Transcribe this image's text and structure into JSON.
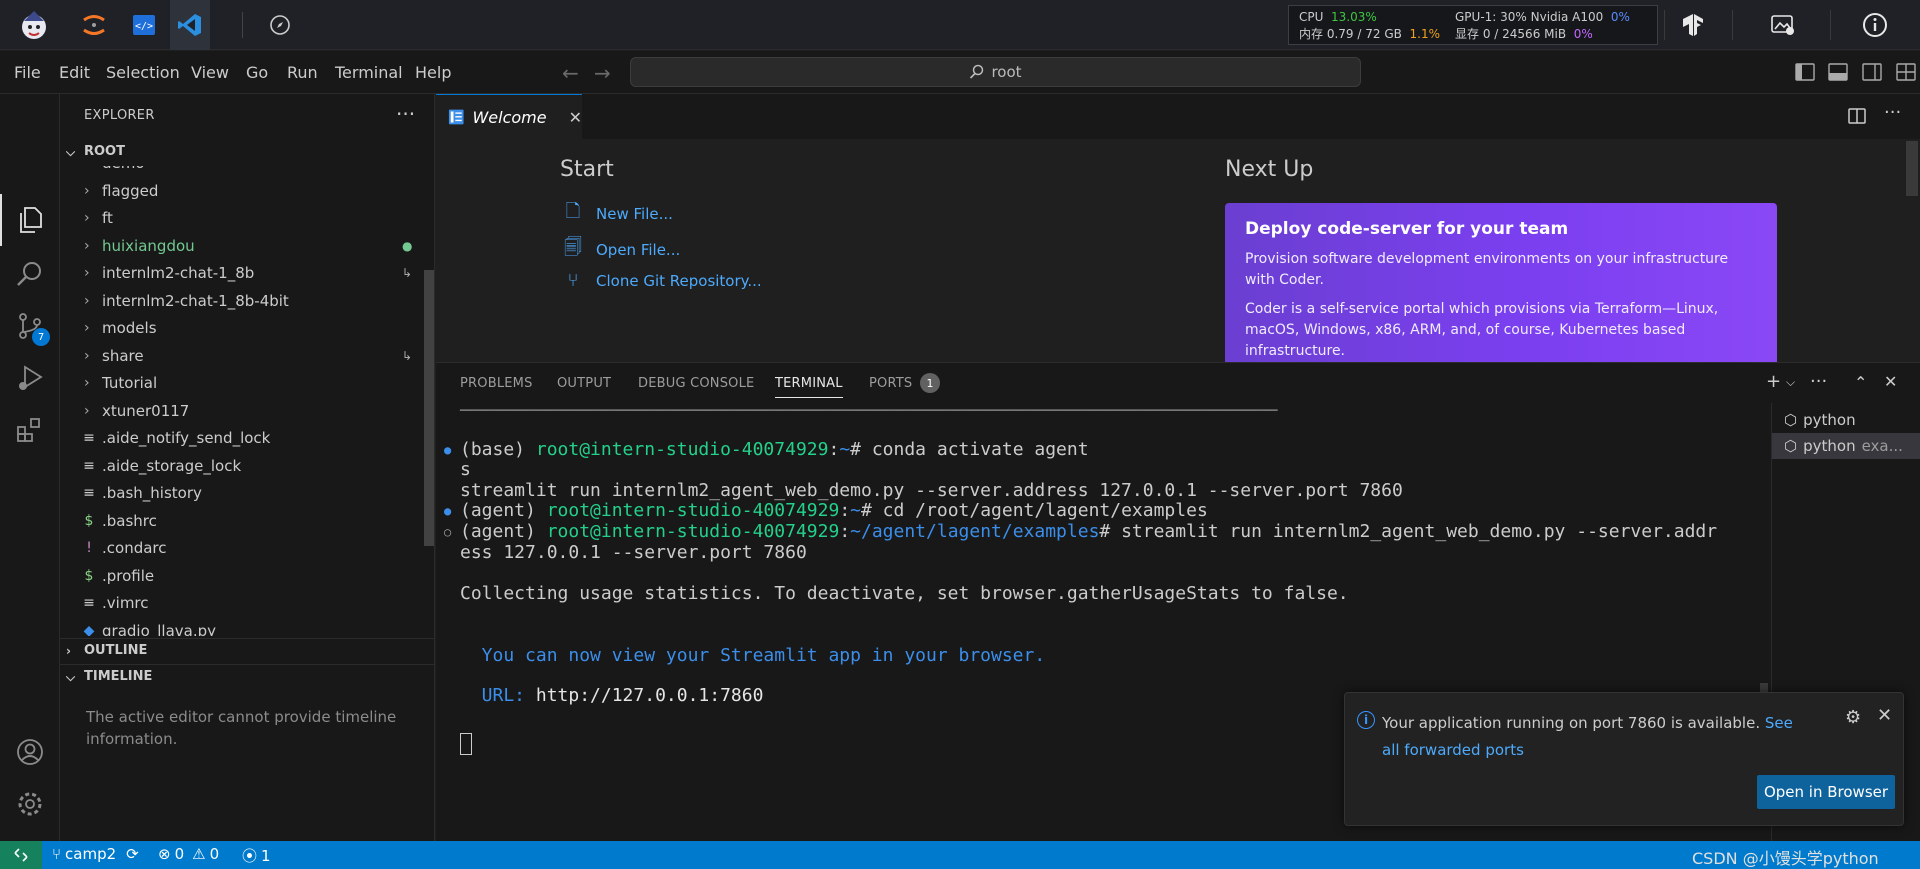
{
  "system_stats": {
    "cpu_label": "CPU",
    "cpu_value": "13.03%",
    "mem_label": "内存",
    "mem_value": "0.79 / 72 GB",
    "mem_percent": "1.1%",
    "gpu_label": "GPU-1: 30% Nvidia A100",
    "gpu_percent": "0%",
    "vram_label": "显存",
    "vram_value": "0 / 24566 MiB",
    "vram_percent": "0%"
  },
  "menu": [
    "File",
    "Edit",
    "Selection",
    "View",
    "Go",
    "Run",
    "Terminal",
    "Help"
  ],
  "command_center": {
    "text": "root"
  },
  "activity_bar": {
    "scm_badge": "7"
  },
  "explorer": {
    "title": "EXPLORER",
    "more": "···",
    "root_label": "ROOT",
    "items": [
      {
        "label": "demo",
        "type": "folder"
      },
      {
        "label": "flagged",
        "type": "folder"
      },
      {
        "label": "ft",
        "type": "folder"
      },
      {
        "label": "huixiangdou",
        "type": "folder",
        "color": "#73c991",
        "mark": "●"
      },
      {
        "label": "internlm2-chat-1_8b",
        "type": "folder",
        "mark": "↳"
      },
      {
        "label": "internlm2-chat-1_8b-4bit",
        "type": "folder"
      },
      {
        "label": "models",
        "type": "folder"
      },
      {
        "label": "share",
        "type": "folder",
        "mark": "↳"
      },
      {
        "label": "Tutorial",
        "type": "folder"
      },
      {
        "label": "xtuner0117",
        "type": "folder"
      },
      {
        "label": ".aide_notify_send_lock",
        "type": "file",
        "icon": "≡",
        "icon_color": "#cccccc"
      },
      {
        "label": ".aide_storage_lock",
        "type": "file",
        "icon": "≡",
        "icon_color": "#cccccc"
      },
      {
        "label": ".bash_history",
        "type": "file",
        "icon": "≡",
        "icon_color": "#cccccc"
      },
      {
        "label": ".bashrc",
        "type": "file",
        "icon": "$",
        "icon_color": "#89d185"
      },
      {
        "label": ".condarc",
        "type": "file",
        "icon": "!",
        "icon_color": "#c586c0"
      },
      {
        "label": ".profile",
        "type": "file",
        "icon": "$",
        "icon_color": "#89d185"
      },
      {
        "label": ".vimrc",
        "type": "file",
        "icon": "≡",
        "icon_color": "#cccccc"
      },
      {
        "label": "gradio_llava.py",
        "type": "file",
        "icon": "◆",
        "icon_color": "#3b8eea"
      }
    ],
    "outline_label": "OUTLINE",
    "timeline_label": "TIMELINE",
    "timeline_message": "The active editor cannot provide timeline information."
  },
  "editor": {
    "tab_label": "Welcome",
    "start_heading": "Start",
    "start_links": [
      "New File...",
      "Open File...",
      "Clone Git Repository..."
    ],
    "next_up_heading": "Next Up",
    "coder_card": {
      "title": "Deploy code-server for your team",
      "para1": "Provision software development environments on your infrastructure with Coder.",
      "para2": "Coder is a self-service portal which provisions via Terraform—Linux, macOS, Windows, x86, ARM, and, of course, Kubernetes based infrastructure."
    }
  },
  "panel": {
    "tabs": [
      "PROBLEMS",
      "OUTPUT",
      "DEBUG CONSOLE",
      "TERMINAL",
      "PORTS"
    ],
    "active_tab": "TERMINAL",
    "ports_badge": "1",
    "terminal": {
      "separator": "─────────────────────────────────────────────────────────────────────────────────────────────────",
      "line1_env": "(base) ",
      "line1_user": "root@intern-studio-40074929",
      "line1_colon": ":",
      "line1_path": "~",
      "line1_cmd": "# conda activate agent",
      "line2": "s",
      "line3": "streamlit run internlm2_agent_web_demo.py --server.address 127.0.0.1 --server.port 7860",
      "line4_env": "(agent) ",
      "line4_user": "root@intern-studio-40074929",
      "line4_colon": ":",
      "line4_path": "~",
      "line4_cmd": "# cd /root/agent/lagent/examples",
      "line5_env": "(agent) ",
      "line5_user": "root@intern-studio-40074929",
      "line5_colon": ":",
      "line5_path": "~/agent/lagent/examples",
      "line5_cmd": "# streamlit run internlm2_agent_web_demo.py --server.addr",
      "line6": "ess 127.0.0.1 --server.port 7860",
      "line7": "Collecting usage statistics. To deactivate, set browser.gatherUsageStats to false.",
      "line8": "  You can now view your Streamlit app in your browser.",
      "line9_label": "  URL: ",
      "line9_url": "http://127.0.0.1:7860"
    },
    "terminal_list": [
      {
        "name": "python",
        "suffix": ""
      },
      {
        "name": "python",
        "suffix": "exa..."
      }
    ]
  },
  "notification": {
    "message": "Your application running on port 7860 is available.",
    "link": "See all forwarded ports",
    "button": "Open in Browser"
  },
  "status_bar": {
    "branch": "camp2",
    "errors": "0",
    "warnings": "0",
    "ports": "1",
    "watermark": "CSDN @小馒头学python"
  }
}
